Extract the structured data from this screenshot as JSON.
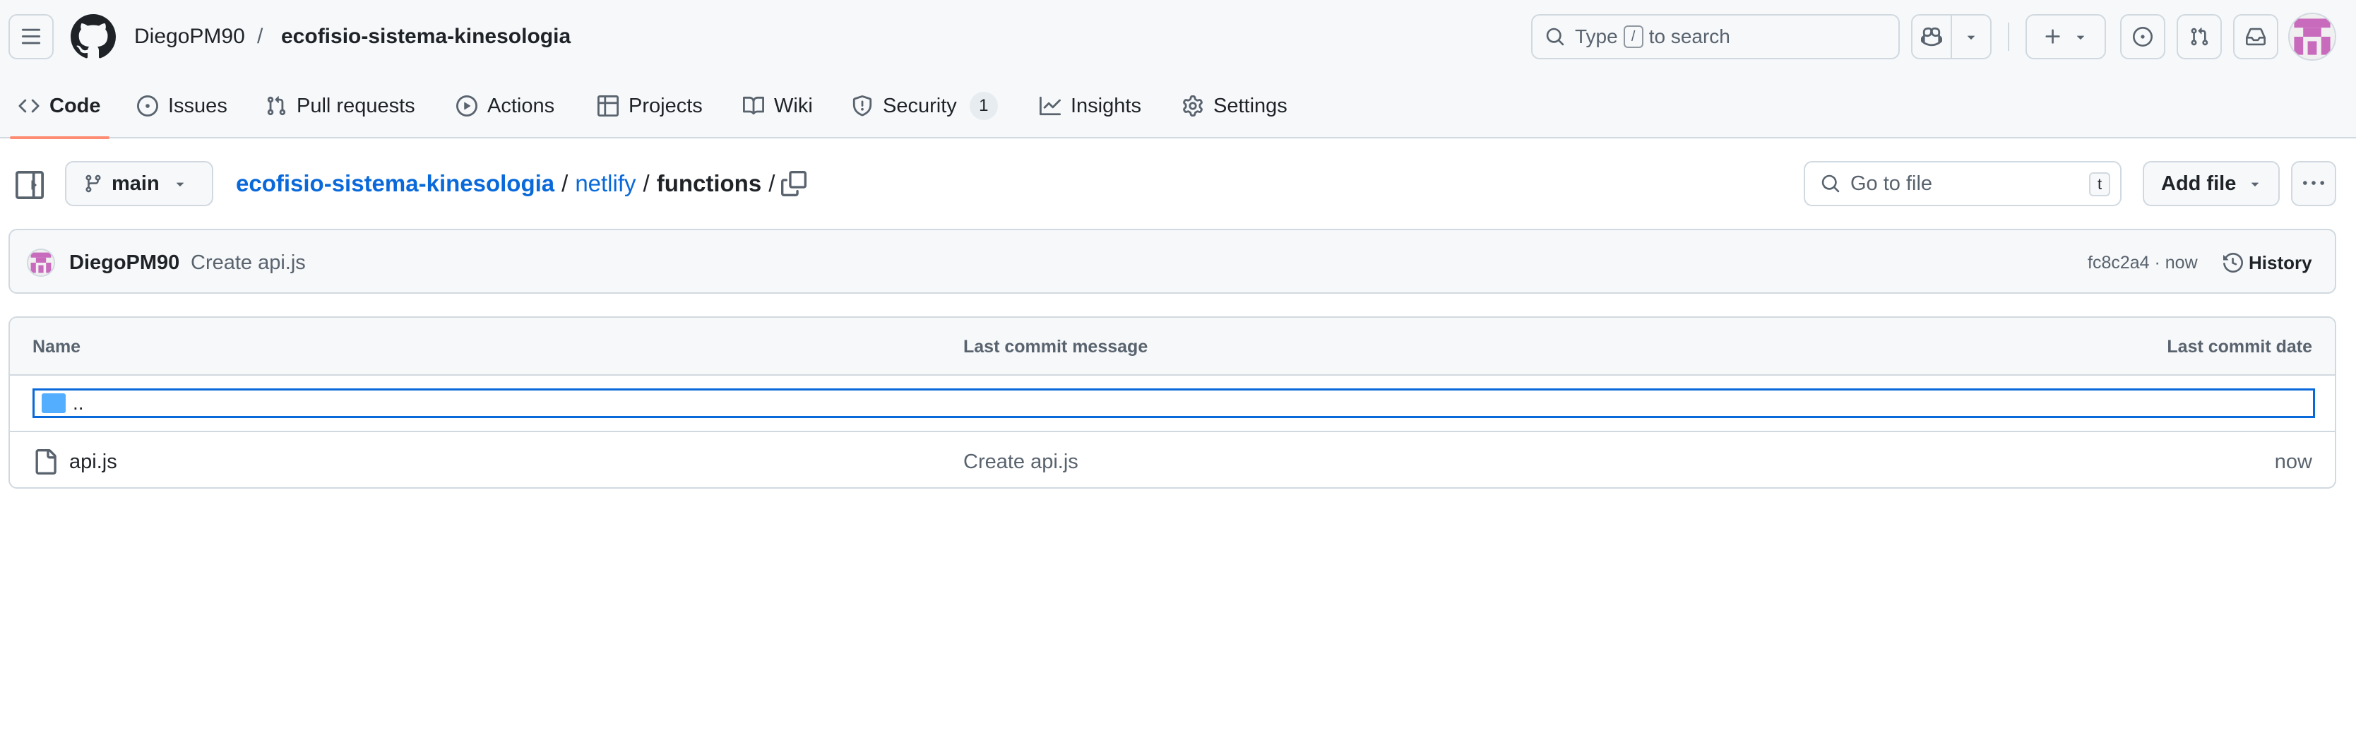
{
  "topbar": {
    "owner": "DiegoPM90",
    "separator": "/",
    "repo": "ecofisio-sistema-kinesologia",
    "search_prefix": "Type",
    "search_key": "/",
    "search_suffix": "to search"
  },
  "nav": {
    "tabs": [
      {
        "label": "Code",
        "icon": "code-icon",
        "active": true
      },
      {
        "label": "Issues",
        "icon": "issue-opened-icon"
      },
      {
        "label": "Pull requests",
        "icon": "git-pull-request-icon"
      },
      {
        "label": "Actions",
        "icon": "play-icon"
      },
      {
        "label": "Projects",
        "icon": "table-icon"
      },
      {
        "label": "Wiki",
        "icon": "book-icon"
      },
      {
        "label": "Security",
        "icon": "shield-icon",
        "count": "1"
      },
      {
        "label": "Insights",
        "icon": "graph-icon"
      },
      {
        "label": "Settings",
        "icon": "gear-icon"
      }
    ]
  },
  "subbar": {
    "branch": "main",
    "breadcrumb": {
      "repo": "ecofisio-sistema-kinesologia",
      "folder": "netlify",
      "current": "functions",
      "sep": "/"
    },
    "go_to_file": "Go to file",
    "go_to_file_key": "t",
    "add_file": "Add file"
  },
  "commit": {
    "author": "DiegoPM90",
    "message": "Create api.js",
    "meta": "fc8c2a4 · now",
    "history": "History"
  },
  "table": {
    "headers": {
      "name": "Name",
      "message": "Last commit message",
      "date": "Last commit date"
    },
    "parent_label": "..",
    "rows": [
      {
        "name": "api.js",
        "message": "Create api.js",
        "date": "now"
      }
    ]
  },
  "colors": {
    "accent": "#0969da",
    "active_tab_underline": "#fd8c73",
    "folder": "#54aeff",
    "avatar": "#c86bbd"
  }
}
